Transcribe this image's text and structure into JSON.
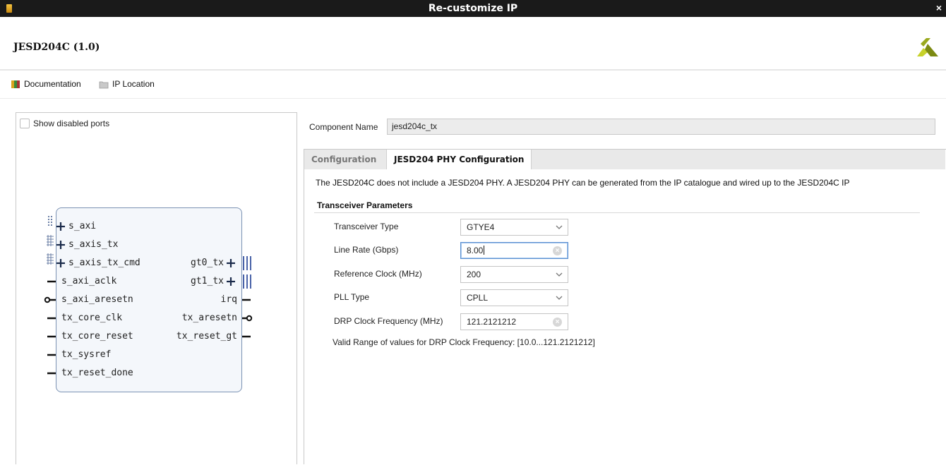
{
  "window": {
    "title": "Re-customize IP",
    "close_glyph": "×"
  },
  "header": {
    "ip_name": "JESD204C (1.0)",
    "logo_icon": "vendor-logo-icon"
  },
  "toolbar": {
    "items": [
      {
        "label": "Documentation",
        "icon": "book-icon"
      },
      {
        "label": "IP Location",
        "icon": "folder-icon"
      }
    ]
  },
  "left_panel": {
    "show_disabled_ports_label": "Show disabled ports",
    "show_disabled_ports_checked": false,
    "left_ports": [
      "s_axi",
      "s_axis_tx",
      "s_axis_tx_cmd",
      "s_axi_aclk",
      "s_axi_aresetn",
      "tx_core_clk",
      "tx_core_reset",
      "tx_sysref",
      "tx_reset_done"
    ],
    "right_ports": [
      "gt0_tx",
      "gt1_tx",
      "irq",
      "tx_aresetn",
      "tx_reset_gt"
    ]
  },
  "component": {
    "label": "Component Name",
    "value": "jesd204c_tx"
  },
  "tabs": [
    {
      "label": "Configuration",
      "active": false
    },
    {
      "label": "JESD204 PHY Configuration",
      "active": true
    }
  ],
  "phy_tab": {
    "note": "The JESD204C does not include a JESD204 PHY. A JESD204 PHY can be generated from the IP catalogue and wired up to the JESD204C IP",
    "section_title": "Transceiver Parameters",
    "params": [
      {
        "label": "Transceiver Type",
        "value": "GTYE4",
        "control": "dropdown"
      },
      {
        "label": "Line Rate (Gbps)",
        "value": "8.00",
        "control": "text-clearable"
      },
      {
        "label": "Reference Clock (MHz)",
        "value": "200",
        "control": "dropdown"
      },
      {
        "label": "PLL Type",
        "value": "CPLL",
        "control": "dropdown"
      },
      {
        "label": "DRP Clock Frequency (MHz)",
        "value": "121.2121212",
        "control": "text-clearable"
      }
    ],
    "valid_range": "Valid Range of values for DRP Clock Frequency: [10.0...121.2121212]"
  }
}
